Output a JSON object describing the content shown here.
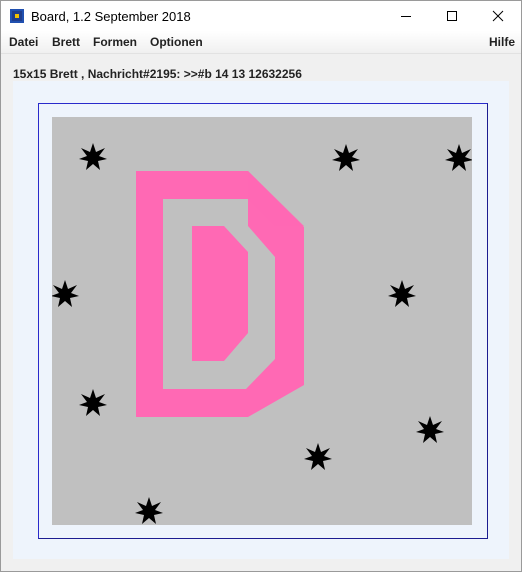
{
  "window": {
    "title": "Board, 1.2 September 2018",
    "icon": "board-app-icon"
  },
  "controls": {
    "minimize_icon": "minimize-icon",
    "maximize_icon": "maximize-icon",
    "close_icon": "close-icon"
  },
  "menu": {
    "datei": "Datei",
    "brett": "Brett",
    "formen": "Formen",
    "optionen": "Optionen",
    "hilfe": "Hilfe"
  },
  "status": "15x15 Brett , Nachricht#2195: >>#b 14 13 12632256",
  "board": {
    "size": 15,
    "background": "#c0c0c0",
    "shape_color": "#ff69b4",
    "star_color": "#000000",
    "shape": "letter D outline with inner D",
    "stars": 10
  }
}
